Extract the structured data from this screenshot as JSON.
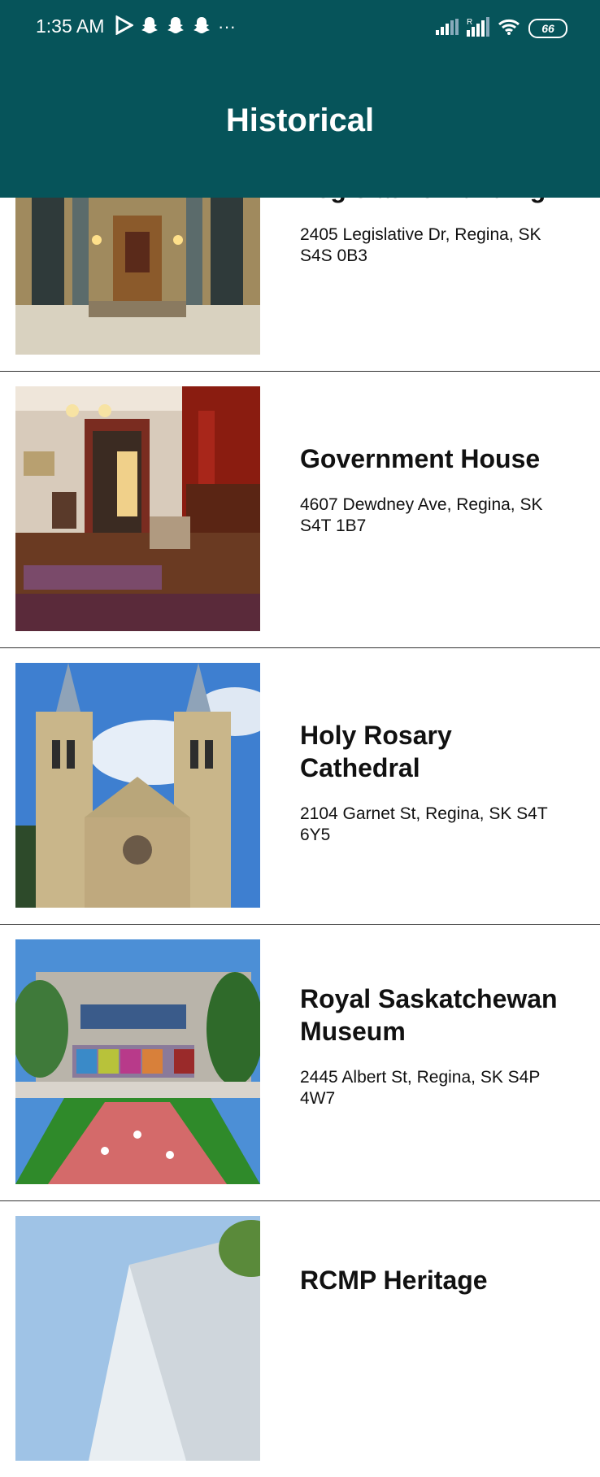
{
  "status_bar": {
    "time": "1:35 AM",
    "more_glyph": "···",
    "battery": "66"
  },
  "header": {
    "title": "Historical"
  },
  "places": [
    {
      "name": " Legislative Building",
      "address": " 2405 Legislative Dr, Regina, SK S4S 0B3"
    },
    {
      "name": " Government House",
      "address": " 4607 Dewdney Ave, Regina, SK S4T 1B7"
    },
    {
      "name": " Holy Rosary Cathedral",
      "address": " 2104 Garnet St, Regina, SK S4T 6Y5"
    },
    {
      "name": " Royal Saskatchewan Museum",
      "address": " 2445 Albert St, Regina, SK S4P 4W7"
    },
    {
      "name": " RCMP Heritage",
      "address": ""
    }
  ],
  "colors": {
    "header_bg": "#06545A",
    "text": "#111111"
  }
}
